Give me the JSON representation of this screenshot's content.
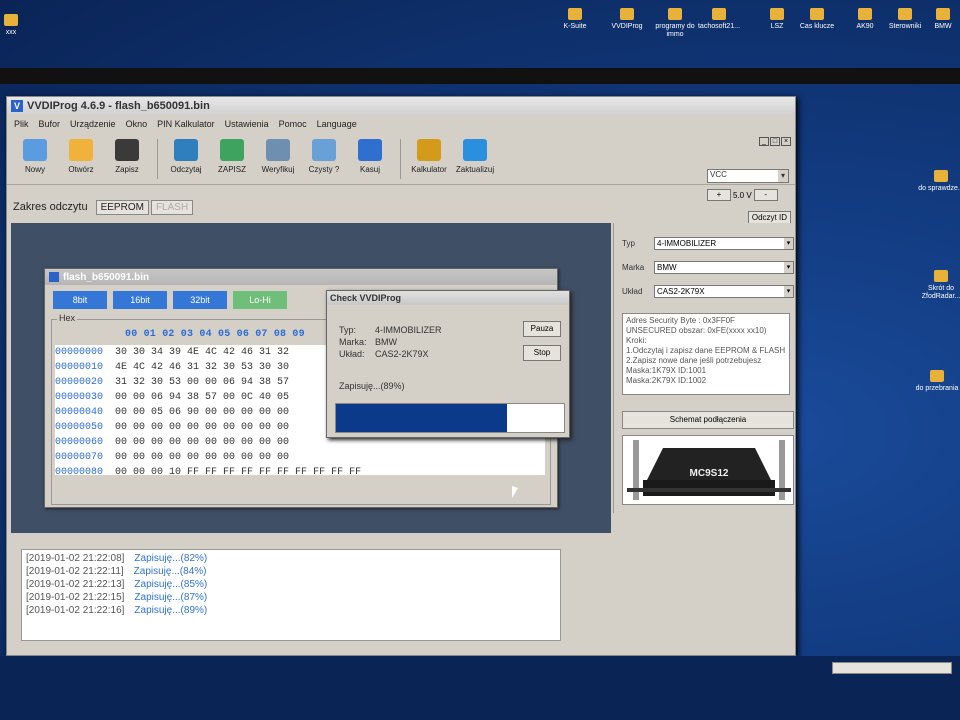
{
  "desktop": {
    "icons": [
      {
        "label": "xxx"
      },
      {
        "label": "K-Suite"
      },
      {
        "label": "VVDIProg"
      },
      {
        "label": "programy do immo"
      },
      {
        "label": "tachosoft21..."
      },
      {
        "label": "LSZ"
      },
      {
        "label": "Cas klucze"
      },
      {
        "label": "AK90"
      },
      {
        "label": "Sterowniki"
      },
      {
        "label": "BMW"
      },
      {
        "label": "do sprawdze..."
      },
      {
        "label": "Skrót do ZfodRadar..."
      },
      {
        "label": "do przebrania"
      }
    ]
  },
  "window": {
    "title": "VVDIProg 4.6.9 - flash_b650091.bin"
  },
  "menu": [
    "Plik",
    "Bufor",
    "Urządzenie",
    "Okno",
    "PIN Kalkulator",
    "Ustawienia",
    "Pomoc",
    "Language"
  ],
  "toolbar": [
    {
      "label": "Nowy",
      "icon": "new-file-icon",
      "color": "#5b9be0"
    },
    {
      "label": "Otwórz",
      "icon": "folder-icon",
      "color": "#f0b23a"
    },
    {
      "label": "Zapisz",
      "icon": "save-icon",
      "color": "#3a3a3a"
    },
    {
      "label": "Odczytaj",
      "icon": "read-chip-icon",
      "color": "#2f7fbf"
    },
    {
      "label": "ZAPISZ",
      "icon": "write-chip-icon",
      "color": "#3ea35e"
    },
    {
      "label": "Weryfikuj",
      "icon": "verify-icon",
      "color": "#6f8fb0"
    },
    {
      "label": "Czysty ?",
      "icon": "blank-check-icon",
      "color": "#6aa0d8"
    },
    {
      "label": "Kasuj",
      "icon": "erase-icon",
      "color": "#2e6fcf"
    },
    {
      "label": "Kalkulator",
      "icon": "calculator-icon",
      "color": "#d49a1a"
    },
    {
      "label": "Zaktualizuj",
      "icon": "update-arrow-icon",
      "color": "#2b8fe0"
    }
  ],
  "vcc": {
    "value": "VCC",
    "plus": "+",
    "voltage": "5.0 V",
    "minus": "-"
  },
  "zakres": {
    "label": "Zakres odczytu",
    "tab_eeprom": "EEPROM",
    "tab_flash": "FLASH"
  },
  "odczyt_id": "Odczyt ID",
  "right": {
    "typ_label": "Typ",
    "typ_value": "4-IMMOBILIZER",
    "marka_label": "Marka",
    "marka_value": "BMW",
    "uklad_label": "Układ",
    "uklad_value": "CAS2-2K79X",
    "info": [
      "Adres Security Byte : 0x3FF0F",
      "UNSECURED obszar: 0xFE(xxxx xx10)",
      "Kroki:",
      "1.Odczytaj i zapisz dane EEPROM & FLASH",
      "2.Zapisz nowe dane jeśli potrzebujesz",
      "Maska:1K79X ID:1001",
      "Maska:2K79X ID:1002"
    ],
    "schemat": "Schemat podłączenia",
    "chip_label": "MC9S12"
  },
  "flash": {
    "title": "flash_b650091.bin",
    "buttons": [
      "8bit",
      "16bit",
      "32bit",
      "Lo-Hi"
    ],
    "hex_label": "Hex",
    "header": "00 01 02 03 04 05 06 07 08 09",
    "rows": [
      {
        "addr": "00000000",
        "bytes": "30 30 34 39 4E 4C 42 46 31 32"
      },
      {
        "addr": "00000010",
        "bytes": "4E 4C 42 46 31 32 30 53 30 30"
      },
      {
        "addr": "00000020",
        "bytes": "31 32 30 53 00 00 06 94 38 57"
      },
      {
        "addr": "00000030",
        "bytes": "00 00 06 94 38 57 00 0C 40 05"
      },
      {
        "addr": "00000040",
        "bytes": "00 00 05 06 90 00 00 00 00 00"
      },
      {
        "addr": "00000050",
        "bytes": "00 00 00 00 00 00 00 00 00 00"
      },
      {
        "addr": "00000060",
        "bytes": "00 00 00 00 00 00 00 00 00 00"
      },
      {
        "addr": "00000070",
        "bytes": "00 00 00 00 00 00 00 00 00 00"
      },
      {
        "addr": "00000080",
        "bytes": "00 00 00 10 FF FF FF FF FF FF FF FF FF FF"
      }
    ]
  },
  "dialog": {
    "title": "Check VVDIProg",
    "typ_label": "Typ:",
    "typ_value": "4-IMMOBILIZER",
    "marka_label": "Marka:",
    "marka_value": "BMW",
    "uklad_label": "Układ:",
    "uklad_value": "CAS2-2K79X",
    "status": "Zapisuję...(89%)",
    "pause": "Pauza",
    "stop": "Stop",
    "progress": 0.75
  },
  "log": [
    {
      "ts": "[2019-01-02 21:22:08]",
      "msg": "Zapisuję...(82%)"
    },
    {
      "ts": "[2019-01-02 21:22:11]",
      "msg": "Zapisuję...(84%)"
    },
    {
      "ts": "[2019-01-02 21:22:13]",
      "msg": "Zapisuję...(85%)"
    },
    {
      "ts": "[2019-01-02 21:22:15]",
      "msg": "Zapisuję...(87%)"
    },
    {
      "ts": "[2019-01-02 21:22:16]",
      "msg": "Zapisuję...(89%)"
    }
  ]
}
